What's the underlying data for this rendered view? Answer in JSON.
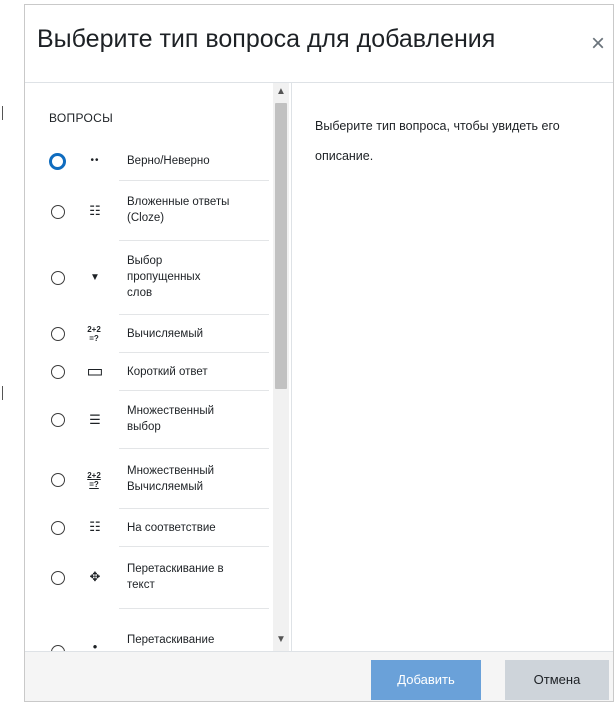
{
  "modal": {
    "title": "Выберите тип вопроса для добавления",
    "close_glyph": "×"
  },
  "options": {
    "heading": "ВОПРОСЫ",
    "selected_index": null,
    "items": [
      {
        "label": "Верно/Неверно",
        "icon": "truefalse-icon",
        "glyph": "••"
      },
      {
        "label": "Вложенные ответы (Cloze)",
        "icon": "cloze-icon",
        "glyph": "☷"
      },
      {
        "label": "Выбор пропущенных слов",
        "icon": "caret-down-icon",
        "glyph": "▼"
      },
      {
        "label": "Вычисляемый",
        "icon": "calculated-icon",
        "glyph": "2+2/=?"
      },
      {
        "label": "Короткий ответ",
        "icon": "shortanswer-icon",
        "glyph": "▭"
      },
      {
        "label": "Множественный выбор",
        "icon": "multichoice-icon",
        "glyph": "☰"
      },
      {
        "label": "Множественный Вычисляемый",
        "icon": "calculatedmulti-icon",
        "glyph": "2+2/=?"
      },
      {
        "label": "На соответствие",
        "icon": "match-icon",
        "glyph": "☷"
      },
      {
        "label": "Перетаскивание в текст",
        "icon": "drag-arrows-icon",
        "glyph": "✥"
      },
      {
        "label": "Перетаскивание",
        "icon": "drag-icon",
        "glyph": "•"
      }
    ]
  },
  "description": {
    "text": "Выберите тип вопроса, чтобы увидеть его описание."
  },
  "footer": {
    "add_label": "Добавить",
    "cancel_label": "Отмена"
  },
  "colors": {
    "primary_button": "#6aa1d9",
    "secondary_button": "#ced4da",
    "focus_ring": "#0f6cbf"
  }
}
